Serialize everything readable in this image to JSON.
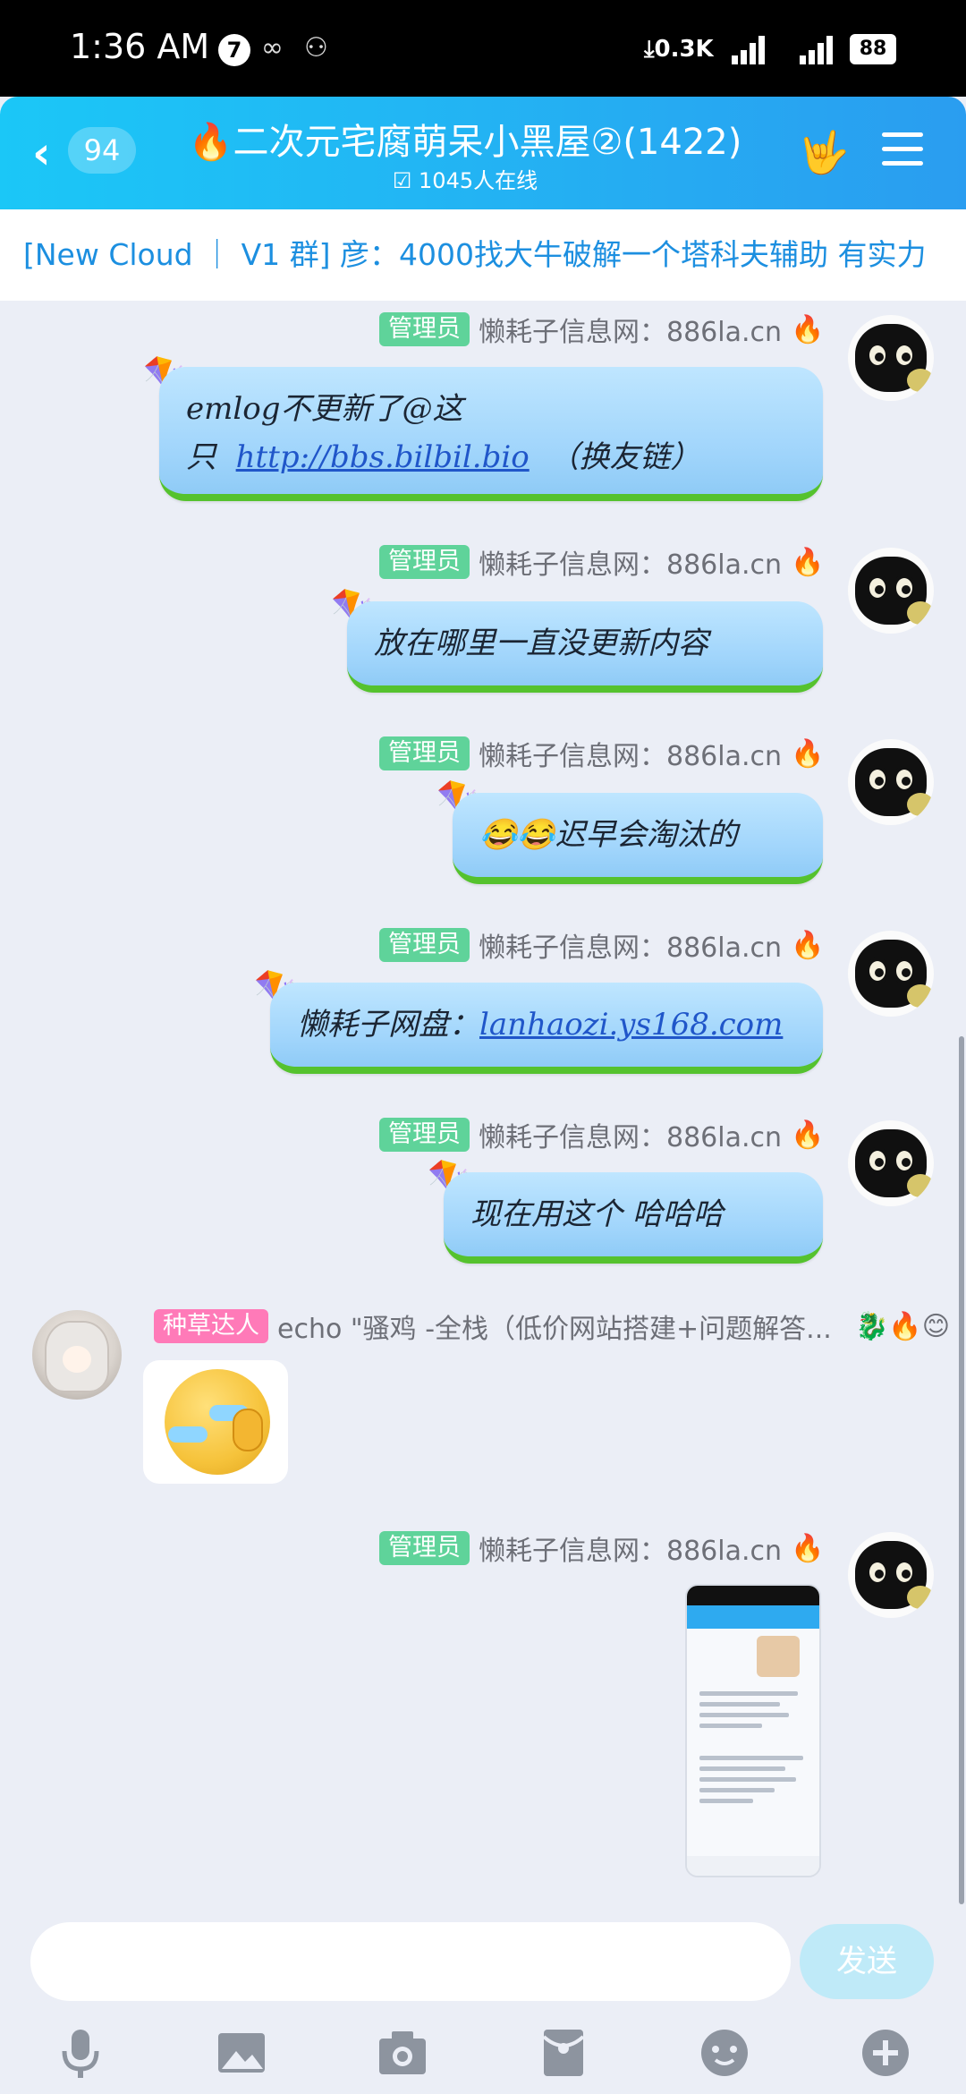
{
  "status_bar": {
    "time": "1:36 AM",
    "badge": "7",
    "net_speed": "⤓0.3K",
    "battery": "88"
  },
  "header": {
    "back_count": "94",
    "title": "🔥二次元宅腐萌呆小黑屋②(1422)",
    "online": "1045人在线"
  },
  "announcement": "[New Cloud ｜ V1 群] 彦：4000找大牛破解一个塔科夫辅助 有实力",
  "messages": [
    {
      "badge": "管理员",
      "name": "懒耗子信息网：886la.cn",
      "text_a": "emlog不更新了@这只",
      "link": "http://bbs.bilbil.bio",
      "text_b": "（换友链）"
    },
    {
      "badge": "管理员",
      "name": "懒耗子信息网：886la.cn",
      "text": "放在哪里一直没更新内容"
    },
    {
      "badge": "管理员",
      "name": "懒耗子信息网：886la.cn",
      "text": "😂😂迟早会淘汰的"
    },
    {
      "badge": "管理员",
      "name": "懒耗子信息网：886la.cn",
      "text_a": "懒耗子网盘：",
      "link": "lanhaozi.ys168.com"
    },
    {
      "badge": "管理员",
      "name": "懒耗子信息网：886la.cn",
      "text": "现在用这个 哈哈哈"
    },
    {
      "badge": "种草达人",
      "name": "echo \"骚鸡 -全栈（低价网站搭建+问题解答...",
      "icons": "🐉🔥😊"
    },
    {
      "badge": "管理员",
      "name": "懒耗子信息网：886la.cn"
    }
  ],
  "input": {
    "placeholder": "",
    "send_label": "发送"
  },
  "toolbar_icons": [
    "microphone-icon",
    "image-icon",
    "camera-icon",
    "red-packet-icon",
    "emoji-icon",
    "plus-icon"
  ],
  "colors": {
    "header": "#23b3f3",
    "admin_badge": "#5fd39a",
    "grass_badge": "#ff7ab8",
    "link": "#2056c9",
    "announcement_text": "#1c8fe0"
  }
}
